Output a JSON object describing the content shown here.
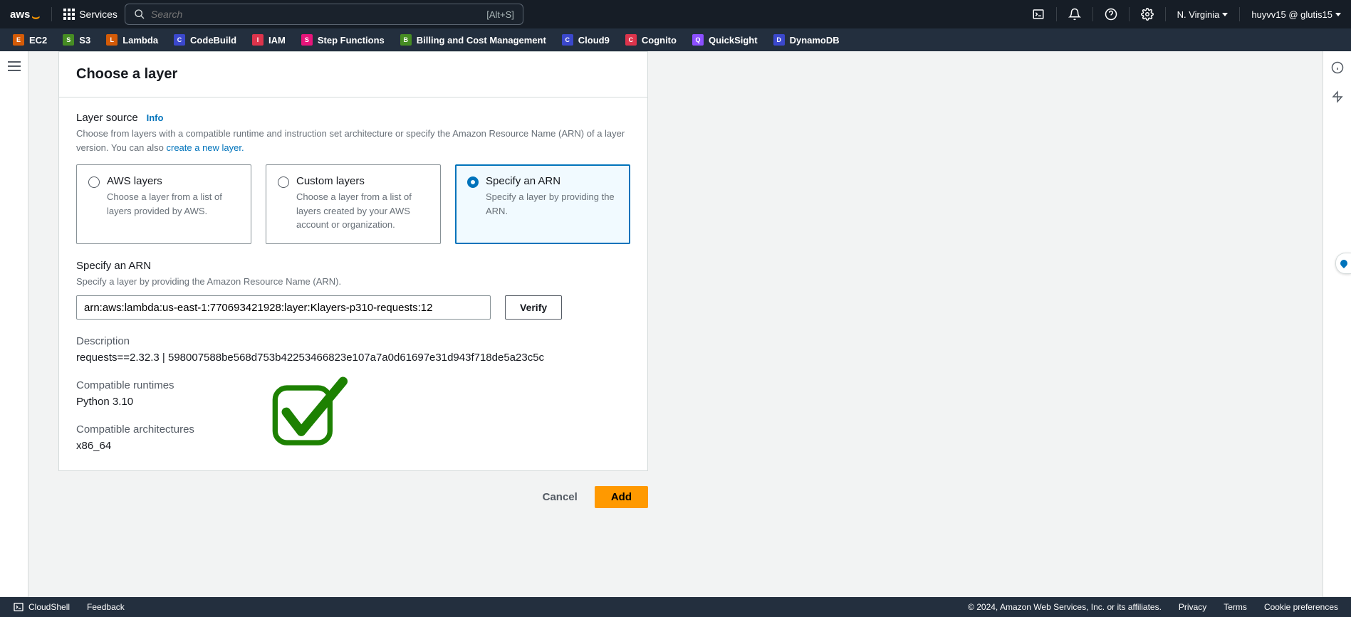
{
  "topnav": {
    "logo": "aws",
    "services_label": "Services",
    "search_placeholder": "Search",
    "search_shortcut": "[Alt+S]",
    "region": "N. Virginia",
    "account": "huyvv15 @ glutis15"
  },
  "shortcuts": [
    {
      "label": "EC2",
      "color": "#d45b07"
    },
    {
      "label": "S3",
      "color": "#468c23"
    },
    {
      "label": "Lambda",
      "color": "#d45b07"
    },
    {
      "label": "CodeBuild",
      "color": "#3b48cc"
    },
    {
      "label": "IAM",
      "color": "#dd344c"
    },
    {
      "label": "Step Functions",
      "color": "#e7157b"
    },
    {
      "label": "Billing and Cost Management",
      "color": "#468c23"
    },
    {
      "label": "Cloud9",
      "color": "#3b48cc"
    },
    {
      "label": "Cognito",
      "color": "#dd344c"
    },
    {
      "label": "QuickSight",
      "color": "#8c4fff"
    },
    {
      "label": "DynamoDB",
      "color": "#3b48cc"
    }
  ],
  "panel": {
    "title": "Choose a layer",
    "layer_source_label": "Layer source",
    "info_label": "Info",
    "layer_source_desc_1": "Choose from layers with a compatible runtime and instruction set architecture or specify the Amazon Resource Name (ARN) of a layer version. You can also ",
    "create_layer_link": "create a new layer.",
    "options": {
      "aws": {
        "title": "AWS layers",
        "desc": "Choose a layer from a list of layers provided by AWS."
      },
      "custom": {
        "title": "Custom layers",
        "desc": "Choose a layer from a list of layers created by your AWS account or organization."
      },
      "arn": {
        "title": "Specify an ARN",
        "desc": "Specify a layer by providing the ARN."
      }
    },
    "arn_section_label": "Specify an ARN",
    "arn_section_desc": "Specify a layer by providing the Amazon Resource Name (ARN).",
    "arn_value": "arn:aws:lambda:us-east-1:770693421928:layer:Klayers-p310-requests:12",
    "verify_label": "Verify",
    "description_label": "Description",
    "description_value": "requests==2.32.3 | 598007588be568d753b42253466823e107a7a0d61697e31d943f718de5a23c5c",
    "runtimes_label": "Compatible runtimes",
    "runtimes_value": "Python 3.10",
    "arch_label": "Compatible architectures",
    "arch_value": "x86_64"
  },
  "actions": {
    "cancel": "Cancel",
    "add": "Add"
  },
  "footer": {
    "cloudshell": "CloudShell",
    "feedback": "Feedback",
    "copyright": "© 2024, Amazon Web Services, Inc. or its affiliates.",
    "privacy": "Privacy",
    "terms": "Terms",
    "cookies": "Cookie preferences"
  }
}
